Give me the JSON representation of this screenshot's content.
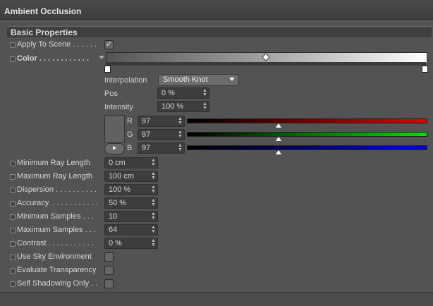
{
  "window": {
    "title": "Ambient Occlusion"
  },
  "section": {
    "title": "Basic Properties"
  },
  "apply_to_scene": {
    "label": "Apply To Scene . . . . . .",
    "checked": true,
    "mark": "✓"
  },
  "color": {
    "label": "Color . . . . . . . . . . . .",
    "interpolation": {
      "label": "Interpolation",
      "value": "Smooth Knot"
    },
    "pos": {
      "label": "Pos",
      "value": "0 %"
    },
    "intensity": {
      "label": "Intensity",
      "value": "100 %"
    },
    "r": {
      "label": "R",
      "value": "97",
      "level": 0.38
    },
    "g": {
      "label": "G",
      "value": "97",
      "level": 0.38
    },
    "b": {
      "label": "B",
      "value": "97",
      "level": 0.38
    }
  },
  "params": [
    {
      "label": "Minimum Ray Length",
      "value": "0 cm"
    },
    {
      "label": "Maximum Ray Length",
      "value": "100 cm"
    },
    {
      "label": "Dispersion . . . . . . . . . .",
      "value": "100 %"
    },
    {
      "label": "Accuracy. . . . . . . . . . . .",
      "value": "50 %"
    },
    {
      "label": "Minimum Samples . . .",
      "value": "10"
    },
    {
      "label": "Maximum Samples . . .",
      "value": "64"
    },
    {
      "label": "Contrast . . . . . . . . . . .",
      "value": "0 %"
    }
  ],
  "checkboxes": [
    {
      "label": "Use Sky Environment",
      "checked": false
    },
    {
      "label": "Evaluate Transparency",
      "checked": false
    },
    {
      "label": "Self Shadowing Only . .",
      "checked": false
    }
  ],
  "colors": {
    "red": "#e00000",
    "green": "#00e000",
    "blue": "#0000e0"
  }
}
